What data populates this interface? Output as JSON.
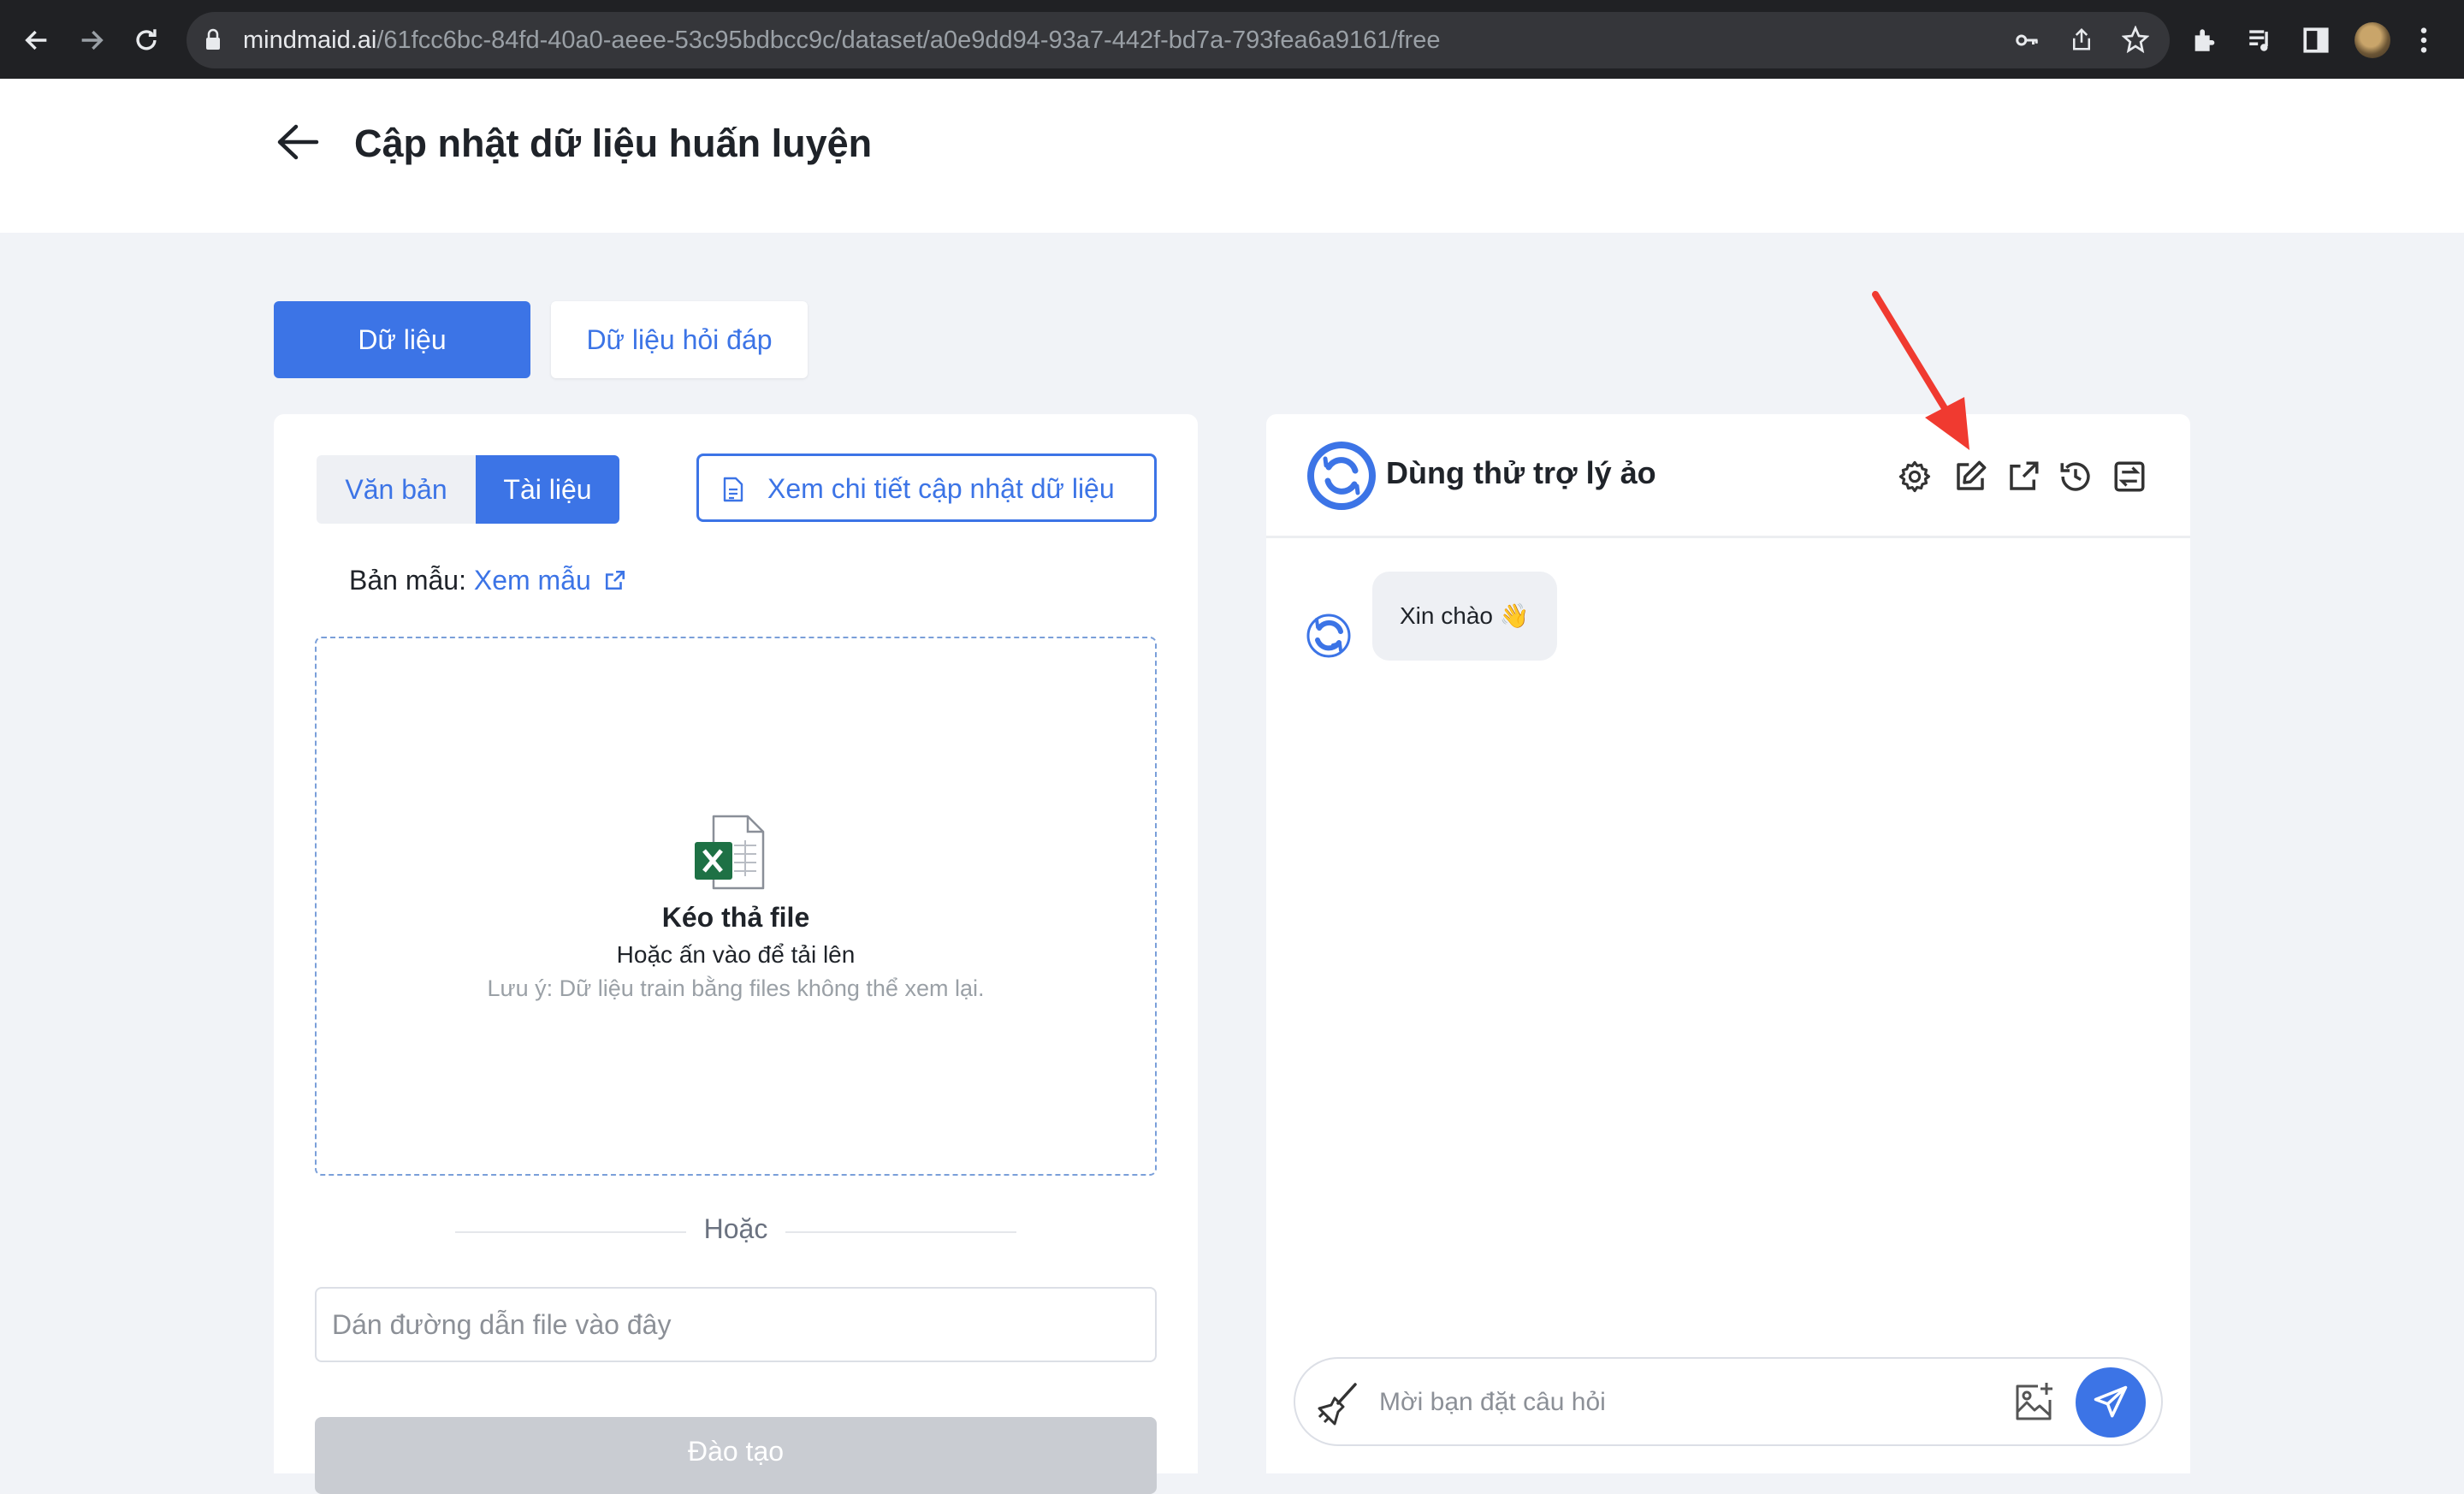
{
  "browser": {
    "url_host": "mindmaid.ai",
    "url_path": "/61fcc6bc-84fd-40a0-aeee-53c95bdbcc9c/dataset/a0e9dd94-93a7-442f-bd7a-793fea6a9161/free",
    "icons": [
      "back-icon",
      "forward-icon",
      "reload-icon",
      "lock-icon",
      "key-icon",
      "share-icon",
      "star-icon",
      "extensions-icon",
      "media-icon",
      "side-panel-icon",
      "avatar",
      "menu-icon"
    ]
  },
  "header": {
    "title": "Cập nhật dữ liệu huấn luyện"
  },
  "tabs": {
    "data_label": "Dữ liệu",
    "qa_label": "Dữ liệu hỏi đáp",
    "active": "Dữ liệu"
  },
  "left_panel": {
    "segments": {
      "text_label": "Văn bản",
      "doc_label": "Tài liệu",
      "active": "Tài liệu"
    },
    "detail_button_label": "Xem chi tiết cập nhật dữ liệu",
    "template_key": "Bản mẫu:",
    "template_link": "Xem mẫu",
    "dropzone": {
      "title": "Kéo thả file",
      "subtitle": "Hoặc ấn vào để tải lên",
      "note": "Lưu ý: Dữ liệu train bằng files không thể xem lại."
    },
    "or_text": "Hoặc",
    "path_input": {
      "placeholder": "Dán đường dẫn file vào đây",
      "value": ""
    },
    "train_button_label": "Đào tạo"
  },
  "chat": {
    "title": "Dùng thử trợ lý ảo",
    "header_icons": [
      "settings-icon",
      "edit-icon",
      "open-external-icon",
      "history-icon",
      "layout-icon"
    ],
    "messages": [
      {
        "from": "bot",
        "text": "Xin chào 👋"
      }
    ],
    "input": {
      "placeholder": "Mời bạn đặt câu hỏi",
      "value": ""
    }
  },
  "colors": {
    "primary": "#3c74e6",
    "page_bg": "#f1f3f7",
    "disabled_button": "#c9ccd2",
    "annotation_arrow": "#f03a30"
  }
}
